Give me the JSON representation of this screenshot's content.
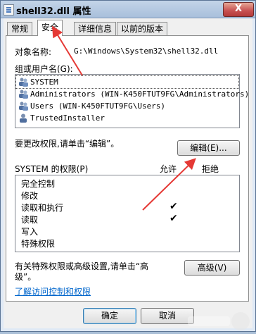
{
  "window": {
    "title": "shell32.dll 属性",
    "close_glyph": "X"
  },
  "tabs": [
    {
      "label": "常规",
      "active": false
    },
    {
      "label": "安全",
      "active": true
    },
    {
      "label": "详细信息",
      "active": false
    },
    {
      "label": "以前的版本",
      "active": false
    }
  ],
  "security": {
    "object_name_label": "对象名称:",
    "object_name_value": "G:\\Windows\\System32\\shell32.dll",
    "groups_label": "组或用户名(G):",
    "groups": [
      {
        "name": "SYSTEM",
        "selected": true,
        "icon": "user-group-icon"
      },
      {
        "name": "Administrators (WIN-K450FTUT9FG\\Administrators)",
        "selected": false,
        "icon": "user-group-icon"
      },
      {
        "name": "Users (WIN-K450FTUT9FG\\Users)",
        "selected": false,
        "icon": "user-group-icon"
      },
      {
        "name": "TrustedInstaller",
        "selected": false,
        "icon": "user-icon"
      }
    ],
    "change_permissions_text": "要更改权限,请单击“编辑”。",
    "edit_button": "编辑(E)...",
    "permissions_label": "SYSTEM 的权限(P)",
    "allow_header": "允许",
    "deny_header": "拒绝",
    "permissions": [
      {
        "name": "完全控制",
        "allow": false,
        "deny": false
      },
      {
        "name": "修改",
        "allow": false,
        "deny": false
      },
      {
        "name": "读取和执行",
        "allow": true,
        "deny": false
      },
      {
        "name": "读取",
        "allow": true,
        "deny": false
      },
      {
        "name": "写入",
        "allow": false,
        "deny": false
      },
      {
        "name": "特殊权限",
        "allow": false,
        "deny": false
      }
    ],
    "check_glyph": "✔",
    "special_text_line1": "有关特殊权限或高级设置,请单击“高",
    "special_text_line2": "级”。",
    "advanced_button": "高级(V)",
    "learn_link": "了解访问控制和权限"
  },
  "footer": {
    "ok_button": "确定",
    "cancel_button": "取消"
  },
  "colors": {
    "annotation_arrow": "#e53935",
    "link": "#0066cc"
  }
}
